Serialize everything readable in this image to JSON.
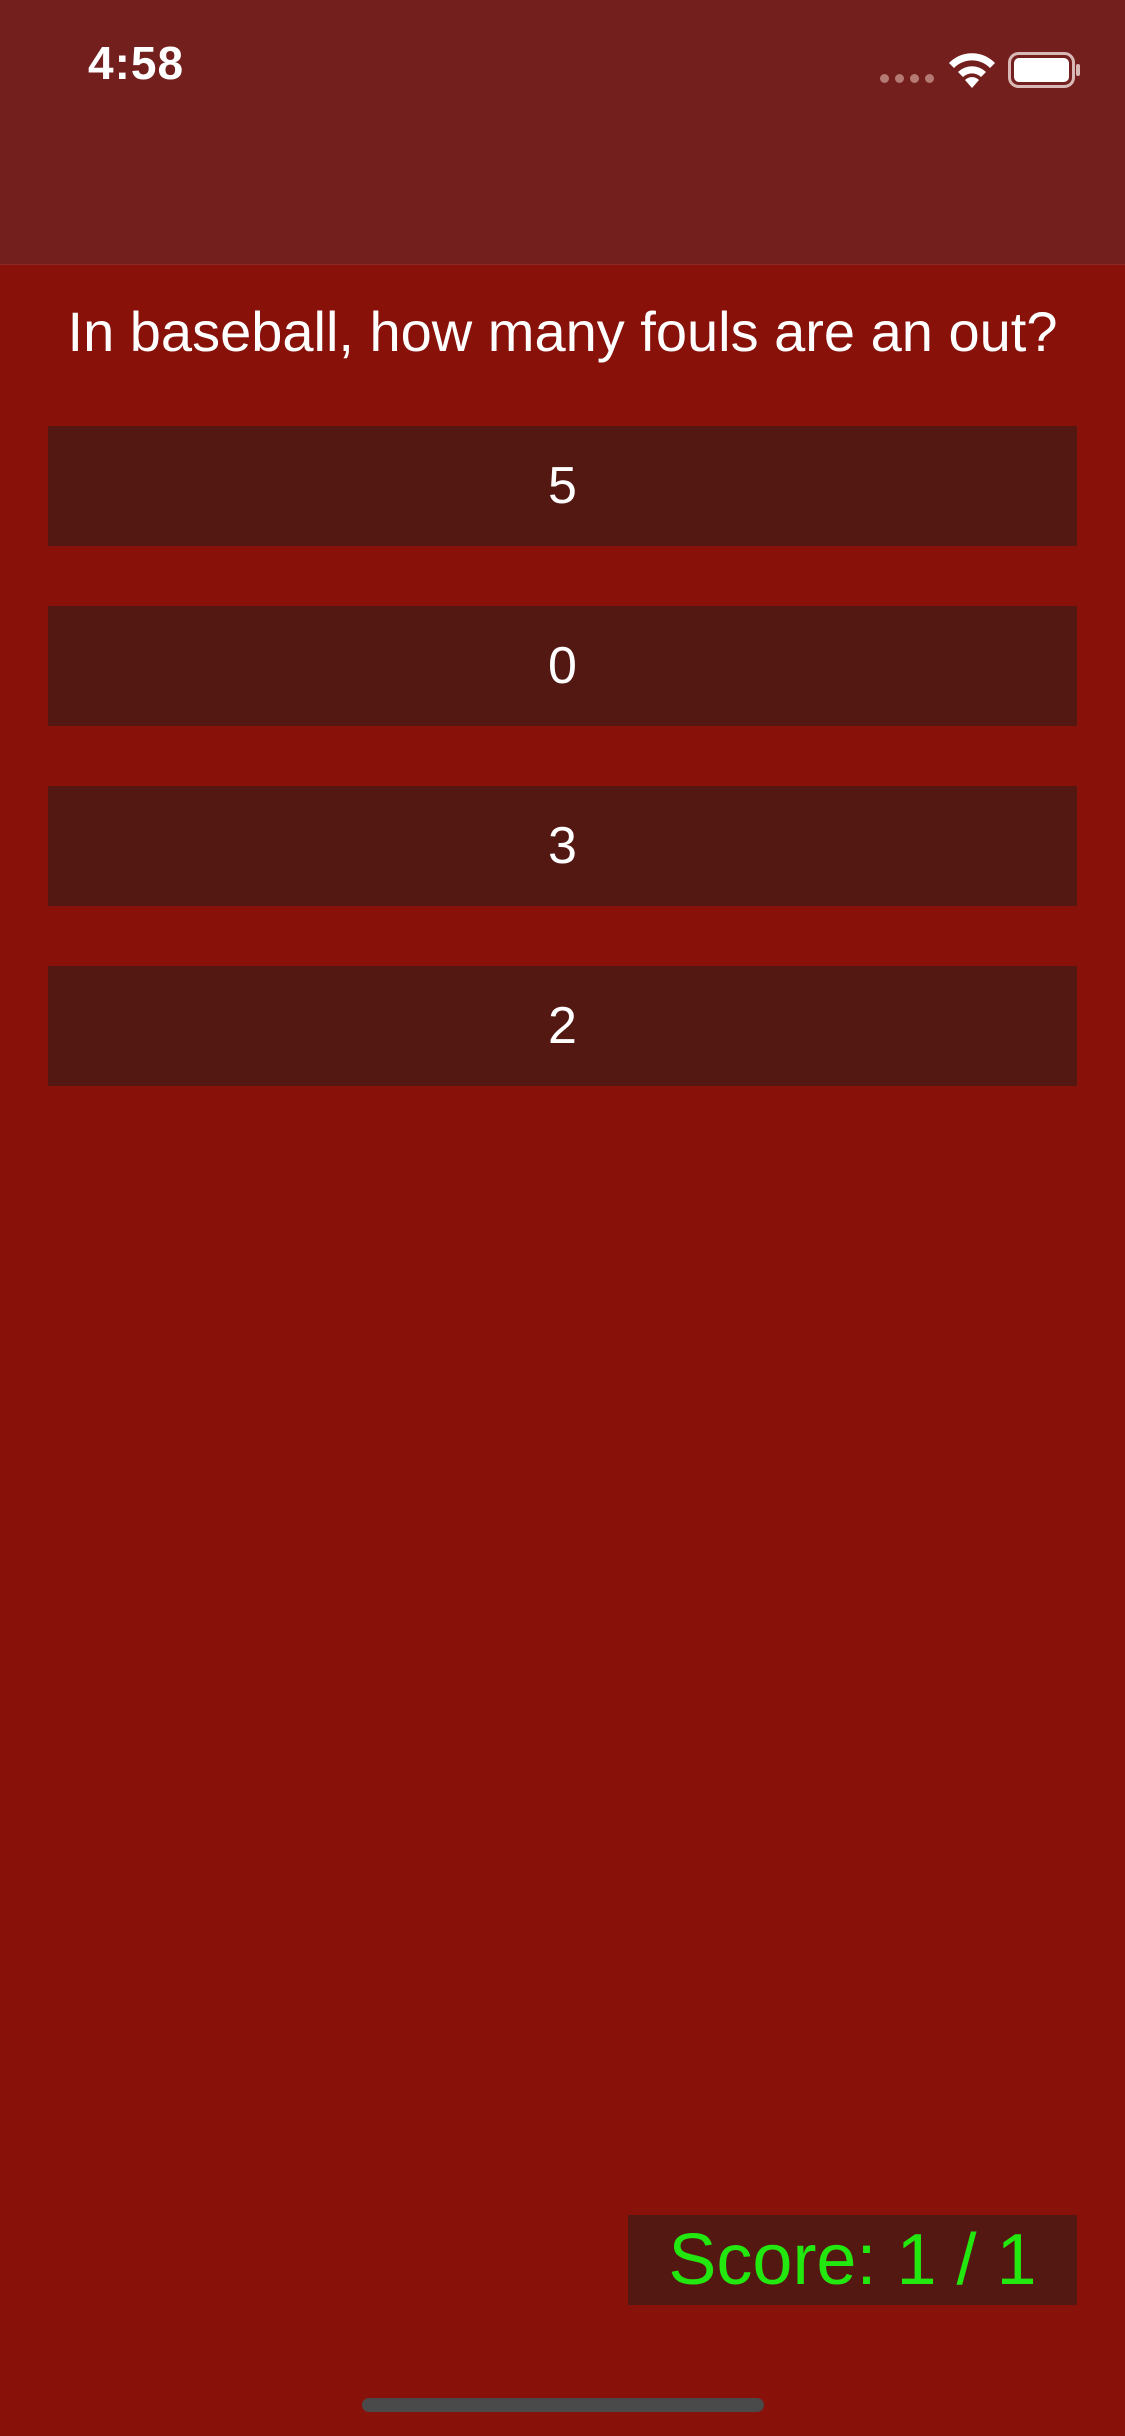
{
  "status_bar": {
    "time": "4:58",
    "signal_icon": "cellular-signal-icon",
    "wifi_icon": "wifi-icon",
    "battery_icon": "battery-icon"
  },
  "quiz": {
    "question": "In baseball, how many fouls are an out?",
    "answers": [
      "5",
      "0",
      "3",
      "2"
    ],
    "score_label": "Score: 1 / 1"
  },
  "colors": {
    "background": "#88110A",
    "header": "#731F1D",
    "button": "#541813",
    "score_text": "#22E80F"
  }
}
